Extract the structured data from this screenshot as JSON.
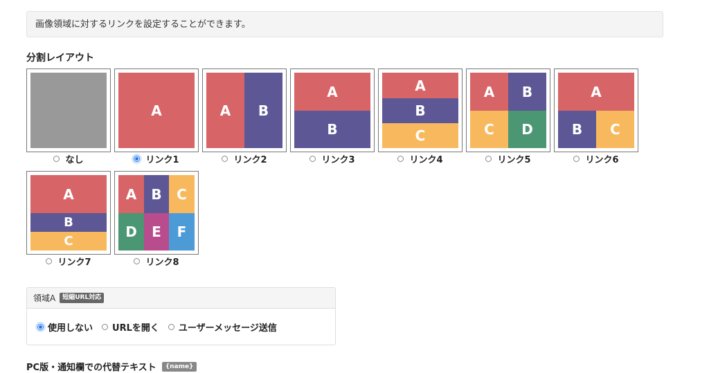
{
  "info": {
    "text": "画像領域に対するリンクを設定することができます。"
  },
  "layout_section": {
    "title": "分割レイアウト",
    "selected": "リンク1",
    "options": [
      {
        "label": "なし",
        "checked": false
      },
      {
        "label": "リンク1",
        "checked": true
      },
      {
        "label": "リンク2",
        "checked": false
      },
      {
        "label": "リンク3",
        "checked": false
      },
      {
        "label": "リンク4",
        "checked": false
      },
      {
        "label": "リンク5",
        "checked": false
      },
      {
        "label": "リンク6",
        "checked": false
      },
      {
        "label": "リンク7",
        "checked": false
      },
      {
        "label": "リンク8",
        "checked": false
      }
    ],
    "region_letters": [
      "A",
      "B",
      "C",
      "D",
      "E",
      "F"
    ]
  },
  "colors": {
    "gray": "#999999",
    "red": "#d76467",
    "purple": "#5d5795",
    "orange": "#f8b95e",
    "green": "#4b9673",
    "magenta": "#b94c8d",
    "blue": "#4c9bd6",
    "radio_selected": "#1a73e8"
  },
  "area_panel": {
    "title": "領域A",
    "badge": "短縮URL対応",
    "options": [
      {
        "label": "使用しない",
        "checked": true
      },
      {
        "label": "URLを開く",
        "checked": false
      },
      {
        "label": "ユーザーメッセージ送信",
        "checked": false
      }
    ]
  },
  "alt_text": {
    "title": "PC版・通知欄での代替テキスト",
    "badge": "{name}"
  }
}
